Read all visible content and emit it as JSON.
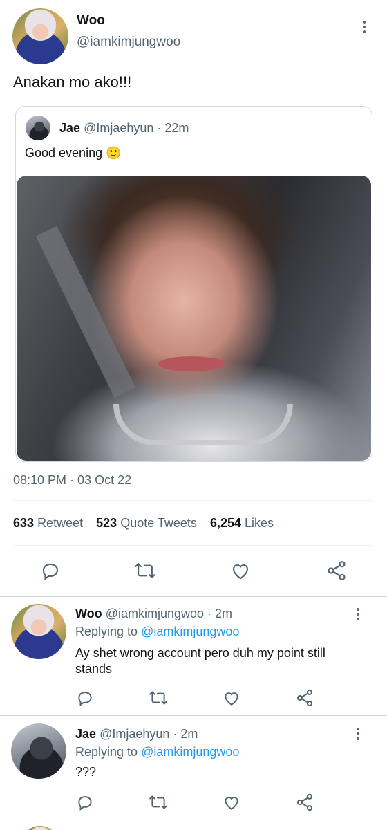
{
  "main_tweet": {
    "display_name": "Woo",
    "handle": "@iamkimjungwoo",
    "text": "Anakan mo ako!!!",
    "timestamp": "08:10 PM · 03 Oct 22"
  },
  "quoted_tweet": {
    "display_name": "Jae",
    "handle": "@Imjaehyun",
    "time": "· 22m",
    "text": "Good evening",
    "emoji": "🙂"
  },
  "stats": {
    "retweets_count": "633",
    "retweets_label": "Retweet",
    "quotes_count": "523",
    "quotes_label": "Quote Tweets",
    "likes_count": "6,254",
    "likes_label": "Likes"
  },
  "replies": [
    {
      "display_name": "Woo",
      "handle": "@iamkimjungwoo",
      "time": "· 2m",
      "replying_prefix": "Replying to",
      "replying_handle": "@iamkimjungwoo",
      "text": "Ay shet wrong account pero duh my point still stands"
    },
    {
      "display_name": "Jae",
      "handle": "@Imjaehyun",
      "time": "· 2m",
      "replying_prefix": "Replying to",
      "replying_handle": "@iamkimjungwoo",
      "text": "???"
    }
  ],
  "colors": {
    "text_primary": "#0f1419",
    "text_secondary": "#536471",
    "accent_link": "#1d9bf0",
    "divider": "#eff3f4"
  },
  "icons": [
    "more-vert-icon",
    "reply-icon",
    "retweet-icon",
    "like-icon",
    "share-icon"
  ]
}
